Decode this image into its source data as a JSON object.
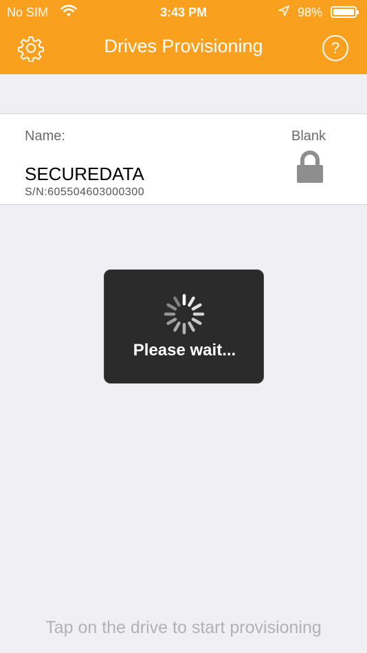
{
  "status_bar": {
    "carrier": "No SIM",
    "time": "3:43 PM",
    "battery": "98%",
    "battery_level": 0.98
  },
  "nav": {
    "title": "Drives Provisioning",
    "settings_icon": "gear-icon",
    "help_label": "?"
  },
  "drive": {
    "name_label": "Name:",
    "name": "SECUREDATA",
    "serial": "S/N:605504603000300",
    "state_label": "Blank",
    "state_icon": "lock-icon"
  },
  "hud": {
    "message": "Please wait..."
  },
  "footer": {
    "hint": "Tap on the drive to start provisioning"
  },
  "colors": {
    "accent": "#f9a11f",
    "background": "#efeff4",
    "hud": "#2b2b2b"
  }
}
